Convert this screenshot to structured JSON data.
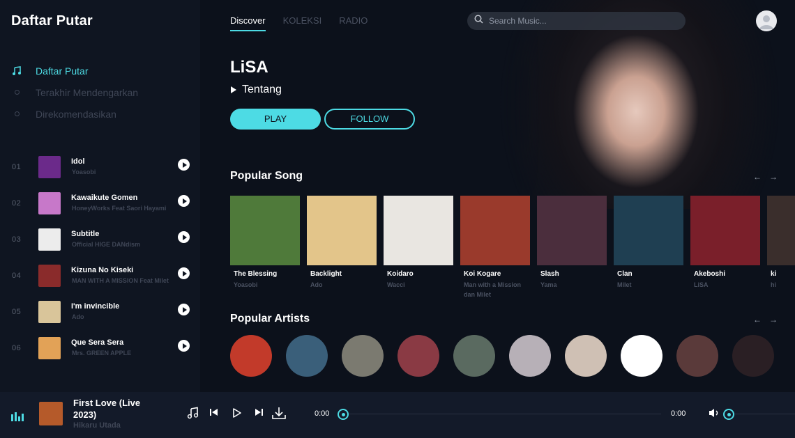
{
  "sidebar": {
    "title": "Daftar Putar",
    "nav": [
      {
        "label": "Daftar Putar",
        "icon": "music-note-icon",
        "active": true
      },
      {
        "label": "Terakhir Mendengarkan",
        "icon": "dot-icon",
        "active": false
      },
      {
        "label": "Direkomendasikan",
        "icon": "dot-icon",
        "active": false
      }
    ],
    "playlist": [
      {
        "num": "01",
        "title": "Idol",
        "artist": "Yoasobi",
        "color": "#6b2a8a"
      },
      {
        "num": "02",
        "title": "Kawaikute Gomen",
        "artist": "HoneyWorks Feat Saori Hayami",
        "color": "#c778c9"
      },
      {
        "num": "03",
        "title": "Subtitle",
        "artist": "Official HIGE DANdism",
        "color": "#ececec"
      },
      {
        "num": "04",
        "title": "Kizuna No Kiseki",
        "artist": "MAN WITH A MISSION Feat Milet",
        "color": "#8a2b2b"
      },
      {
        "num": "05",
        "title": "I'm invincible",
        "artist": "Ado",
        "color": "#d9c59a"
      },
      {
        "num": "06",
        "title": "Que Sera Sera",
        "artist": "Mrs. GREEN APPLE",
        "color": "#e2a257"
      }
    ]
  },
  "header": {
    "tabs": [
      {
        "label": "Discover",
        "active": true
      },
      {
        "label": "KOLEKSI",
        "active": false
      },
      {
        "label": "RADIO",
        "active": false
      }
    ],
    "search_placeholder": "Search Music..."
  },
  "hero": {
    "artist": "LiSA",
    "about_label": "Tentang",
    "play_label": "PLAY",
    "follow_label": "FOLLOW"
  },
  "popular_songs": {
    "title": "Popular Song",
    "prev": "←",
    "next": "→",
    "items": [
      {
        "title": "The Blessing",
        "artist": "Yoasobi",
        "color": "#4f7a3a"
      },
      {
        "title": "Backlight",
        "artist": "Ado",
        "color": "#e3c58a"
      },
      {
        "title": "Koidaro",
        "artist": "Wacci",
        "color": "#e9e6e1"
      },
      {
        "title": "Koi Kogare",
        "artist": "Man with a Mission dan Milet",
        "color": "#9a3a2c"
      },
      {
        "title": "Slash",
        "artist": "Yama",
        "color": "#4b2e3d"
      },
      {
        "title": "Clan",
        "artist": "Milet",
        "color": "#1f3f52"
      },
      {
        "title": "Akeboshi",
        "artist": "LiSA",
        "color": "#7a1f2a"
      },
      {
        "title": "ki",
        "artist": "hi",
        "color": "#3a2e2c"
      }
    ]
  },
  "popular_artists": {
    "title": "Popular Artists",
    "prev": "←",
    "next": "→",
    "colors": [
      "#c23a2a",
      "#3a5f7a",
      "#7b7a70",
      "#8a3a44",
      "#5a6a60",
      "#b7b0b7",
      "#cfc0b4",
      "#ffffff",
      "#5a3a3a",
      "#2a1f24"
    ]
  },
  "player": {
    "title": "First Love (Live 2023)",
    "artist": "Hikaru Utada",
    "cover_color": "#b55a2a",
    "current_time": "0:00",
    "total_time": "0:00"
  }
}
